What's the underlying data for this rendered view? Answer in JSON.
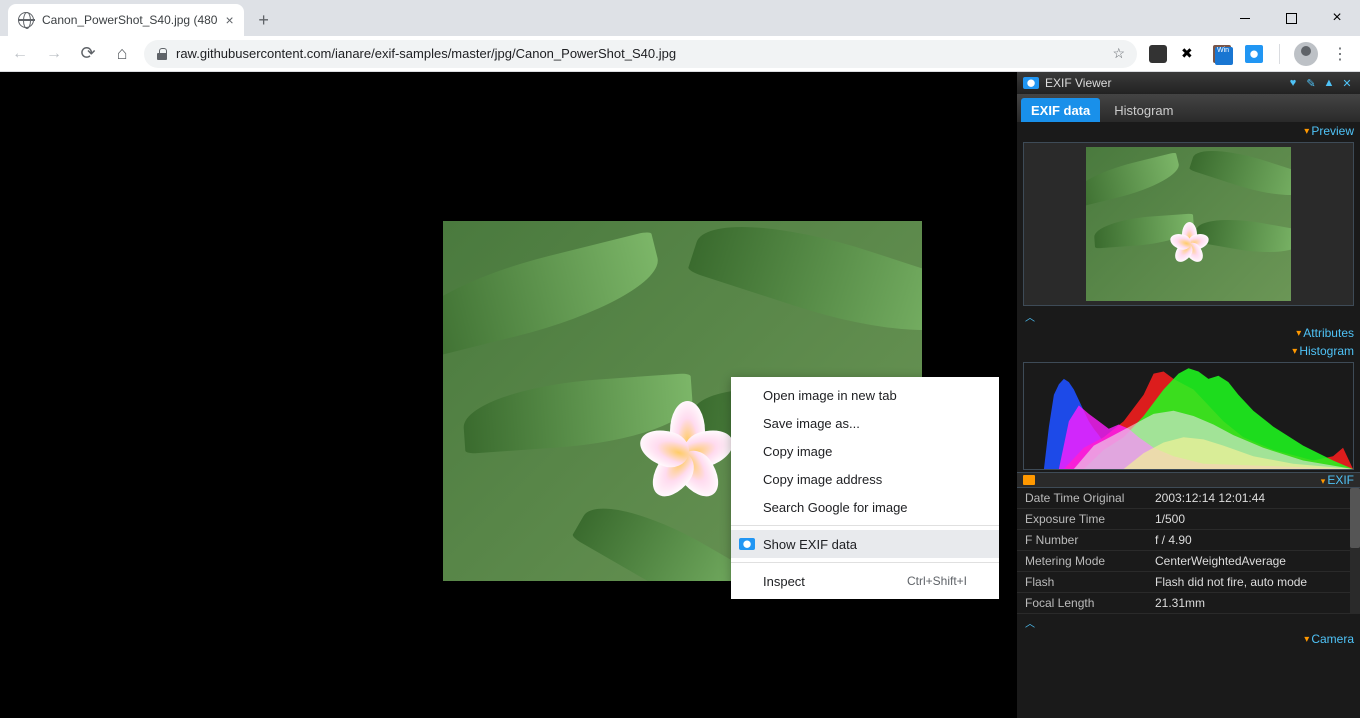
{
  "tab": {
    "title": "Canon_PowerShot_S40.jpg (480"
  },
  "url": "raw.githubusercontent.com/ianare/exif-samples/master/jpg/Canon_PowerShot_S40.jpg",
  "context_menu": {
    "open_new_tab": "Open image in new tab",
    "save_as": "Save image as...",
    "copy_image": "Copy image",
    "copy_address": "Copy image address",
    "search_google": "Search Google for image",
    "show_exif": "Show EXIF data",
    "inspect": "Inspect",
    "inspect_shortcut": "Ctrl+Shift+I"
  },
  "panel": {
    "title": "EXIF Viewer",
    "tabs": {
      "exif": "EXIF data",
      "histogram": "Histogram"
    },
    "sections": {
      "preview": "Preview",
      "attributes": "Attributes",
      "histogram": "Histogram",
      "exif": "EXIF",
      "camera": "Camera"
    },
    "exif_rows": [
      {
        "k": "Date Time Original",
        "v": "2003:12:14 12:01:44"
      },
      {
        "k": "Exposure Time",
        "v": "1/500"
      },
      {
        "k": "F Number",
        "v": "f / 4.90"
      },
      {
        "k": "Metering Mode",
        "v": "CenterWeightedAverage"
      },
      {
        "k": "Flash",
        "v": "Flash did not fire, auto mode"
      },
      {
        "k": "Focal Length",
        "v": "21.31mm"
      }
    ]
  }
}
